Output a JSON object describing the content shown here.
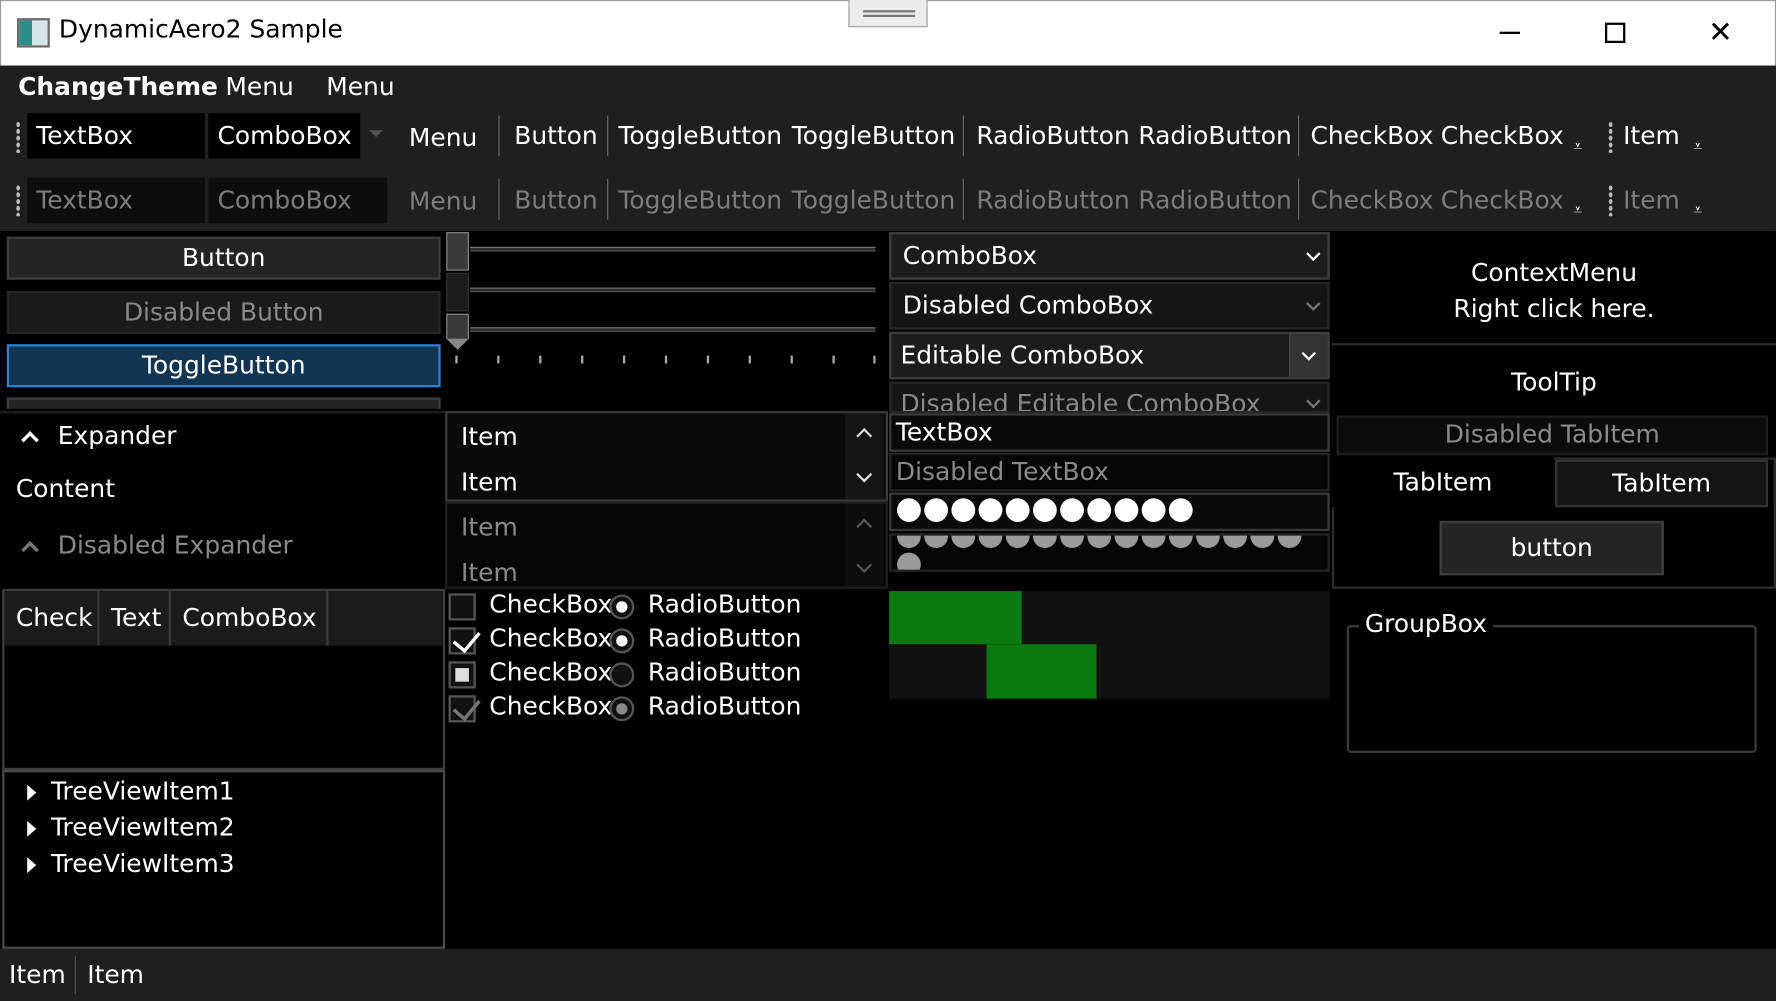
{
  "window": {
    "title": "DynamicAero2 Sample",
    "caption_minimize": "—",
    "caption_maximize": "☐",
    "caption_close": "✕"
  },
  "menubar": {
    "items": [
      "ChangeTheme",
      "Menu",
      "Menu"
    ]
  },
  "toolbar": {
    "textbox": "TextBox",
    "combobox": "ComboBox",
    "menu": "Menu",
    "button": "Button",
    "toggle1": "ToggleButton",
    "toggle2": "ToggleButton",
    "radio1": "RadioButton",
    "radio2": "RadioButton",
    "check1": "CheckBox",
    "check2": "CheckBox",
    "item": "Item"
  },
  "buttons": {
    "button": "Button",
    "disabled_button": "Disabled Button",
    "toggle_button": "ToggleButton"
  },
  "comboboxes": {
    "combo": "ComboBox",
    "disabled_combo": "Disabled ComboBox",
    "editable_combo": "Editable ComboBox",
    "disabled_editable_combo": "Disabled Editable ComboBox"
  },
  "context_area": {
    "line1": "ContextMenu",
    "line2": "Right click here.",
    "tooltip": "ToolTip"
  },
  "expander": {
    "header": "Expander",
    "content": "Content",
    "disabled_header": "Disabled Expander"
  },
  "listboxes": {
    "enabled_items": [
      "Item",
      "Item"
    ],
    "disabled_items": [
      "Item",
      "Item"
    ]
  },
  "textboxes": {
    "textbox": "TextBox",
    "disabled_textbox": "Disabled TextBox",
    "password_dots": 11,
    "disabled_password_dots": 16
  },
  "tabs": {
    "disabled_tab": "Disabled TabItem",
    "tab1": "TabItem",
    "tab2": "TabItem",
    "tab_button": "button"
  },
  "datagrid": {
    "columns": [
      "Check",
      "Text",
      "ComboBox"
    ]
  },
  "checks_radios": {
    "checkbox_label": "CheckBox",
    "radio_label": "RadioButton",
    "rows": [
      {
        "check_state": "unchecked",
        "radio_state": "checked"
      },
      {
        "check_state": "checked",
        "radio_state": "checked"
      },
      {
        "check_state": "indeterminate",
        "radio_state": "unchecked"
      },
      {
        "check_state": "checked-disabled",
        "radio_state": "checked-disabled"
      }
    ]
  },
  "progress": {
    "bar1_fraction": 0.3,
    "bar2_fraction_start": 0.22,
    "bar2_fraction_width": 0.25,
    "fill_color": "#0a7a10"
  },
  "groupbox": {
    "header": "GroupBox"
  },
  "treeview": {
    "items": [
      "TreeViewItem1",
      "TreeViewItem2",
      "TreeViewItem3"
    ]
  },
  "statusbar": {
    "items": [
      "Item",
      "Item"
    ]
  },
  "colors": {
    "background": "#000000",
    "toggle_accent": "#2f7fcc",
    "toggle_fill": "#133554"
  }
}
